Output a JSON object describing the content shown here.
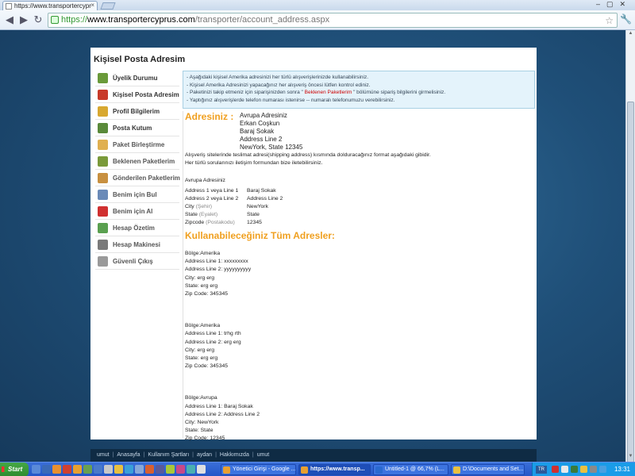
{
  "browser": {
    "tab_title": "https://www.transportercypr",
    "tab_close": "×",
    "window_controls": "–▢✕",
    "url_proto": "https://",
    "url_host": "www.transportercyprus.com",
    "url_path": "/transporter/account_address.aspx"
  },
  "page": {
    "title": "Kişisel Posta Adresim",
    "sidebar": [
      {
        "label": "Üyelik Durumu",
        "icon": "user-icon",
        "color": "#6a9a3a"
      },
      {
        "label": "Kişisel Posta Adresim",
        "icon": "house-icon",
        "color": "#c83a2a"
      },
      {
        "label": "Profil Bilgilerim",
        "icon": "lock-icon",
        "color": "#d8a830"
      },
      {
        "label": "Posta Kutum",
        "icon": "mailbox-icon",
        "color": "#5a8a3a"
      },
      {
        "label": "Paket Birleştirme",
        "icon": "package-icon",
        "color": "#e0b050"
      },
      {
        "label": "Beklenen Paketlerim",
        "icon": "box-green-icon",
        "color": "#7a9a3a"
      },
      {
        "label": "Gönderilen Paketlerim",
        "icon": "box-sent-icon",
        "color": "#c89040"
      },
      {
        "label": "Benim için Bul",
        "icon": "magnifier-icon",
        "color": "#6a8ab8"
      },
      {
        "label": "Benim için Al",
        "icon": "shopping-bag-icon",
        "color": "#d03030"
      },
      {
        "label": "Hesap Özetim",
        "icon": "money-icon",
        "color": "#5aa050"
      },
      {
        "label": "Hesap Makinesi",
        "icon": "calculator-icon",
        "color": "#7a7a7a"
      },
      {
        "label": "Güvenli Çıkış",
        "icon": "gear-icon",
        "color": "#9a9a9a"
      }
    ],
    "info": {
      "line1": "- Aşağıdaki kişisel Amerika adresinizi her türlü alışverişlerinizde kullanabilirsiniz.",
      "line2": "- Kişisel Amerika Adresinizi yapacağınız her alışveriş öncesi lütfen kontrol ediniz.",
      "line3_pre": "- Paketinizi takip etmeniz için siparişinizden sonra \"",
      "line3_hl": " Beklenen Paketlerim ",
      "line3_post": "\" bölümüne sipariş bilgilerini girmelisiniz.",
      "line4": "- Yaptığınız alışverişlerde telefon numarası istenirse -- numaralı telefonumuzu verebilirsiniz."
    },
    "address_title": "Adresiniz :",
    "address_lines": [
      "Avrupa Adresiniz",
      "Erkan Coşkun",
      "Baraj Sokak",
      "Address Line 2",
      "NewYork, State 12345"
    ],
    "note1": "Alışveriş sitelerinde teslimat adresi(shipping address) kısmında dolduracağınız format aşağıdaki gibidir.",
    "note2": "Her türlü sorularınızı iletişim formundan bize iletebilirsiniz.",
    "kv_header": "Avrupa Adresiniz",
    "kv_rows": [
      {
        "k": "Address 1 veya Line 1",
        "sub": "",
        "v": "Baraj Sokak"
      },
      {
        "k": "Address 2 veya Line 2",
        "sub": "",
        "v": "Address Line 2"
      },
      {
        "k": "City ",
        "sub": "(Şehir)",
        "v": "NewYork"
      },
      {
        "k": "State ",
        "sub": "(Eyalet)",
        "v": "State"
      },
      {
        "k": "Zipcode ",
        "sub": "(Postakodu)",
        "v": "12345"
      }
    ],
    "all_title": "Kullanabileceğiniz Tüm Adresler:",
    "blocks": [
      [
        "Bölge:Amerika",
        "Address Line 1: xxxxxxxxx",
        "Address Line 2: yyyyyyyyyy",
        "City: erg erg",
        "State: erg erg",
        "Zip Code: 345345"
      ],
      [
        "Bölge:Amerika",
        "Address Line 1: trhg rth",
        "Address Line 2: erg erg",
        "City: erg erg",
        "State: erg erg",
        "Zip Code: 345345"
      ],
      [
        "Bölge:Avrupa",
        "Address Line 1: Baraj Sokak",
        "Address Line 2: Address Line 2",
        "City: NewYork",
        "State: State",
        "Zip Code: 12345"
      ]
    ],
    "footer": [
      "umut",
      "Anasayfa",
      "Kullanım Şartları",
      "aydan",
      "Hakkımızda",
      "umut"
    ],
    "footer_sep": "|"
  },
  "taskbar": {
    "start": "Start",
    "tasks": [
      {
        "label": "Yönetici Girişi - Google ...",
        "color": "#e8a030"
      },
      {
        "label": "https://www.transp...",
        "color": "#e8a030",
        "active": true
      },
      {
        "label": "Untitled-1 @ 66,7% (L...",
        "color": "#2a6ad0"
      },
      {
        "label": "D:\\Documents and Set...",
        "color": "#e8c040"
      }
    ],
    "lang": "TR",
    "clock": "13:31"
  }
}
